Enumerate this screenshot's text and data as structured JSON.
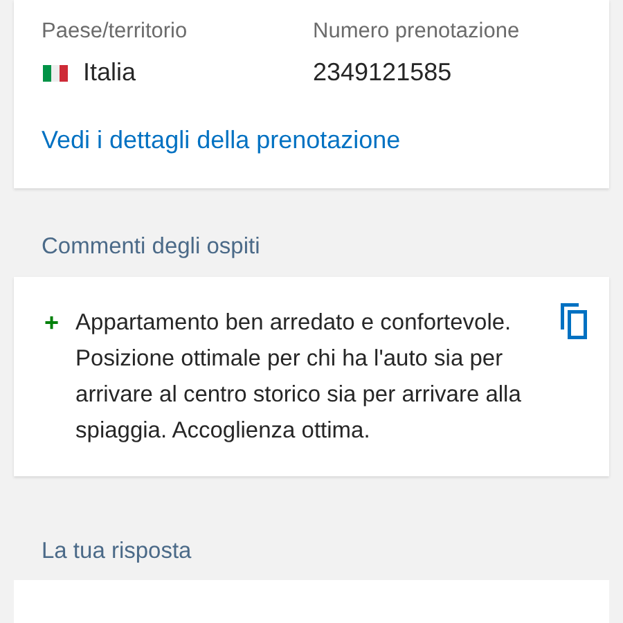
{
  "booking": {
    "country_label": "Paese/territorio",
    "country": "Italia",
    "number_label": "Numero prenotazione",
    "number": "2349121585",
    "details_link": "Vedi i dettagli della prenotazione"
  },
  "comments": {
    "title": "Commenti degli ospiti",
    "items": [
      {
        "kind": "positive",
        "sign": "+",
        "text": "Appartamento ben arredato e confortevole. Posizione ottimale per chi ha l'auto sia per arrivare al centro storico sia per arrivare alla spiaggia. Accoglienza ottima."
      }
    ]
  },
  "reply": {
    "title": "La tua risposta"
  }
}
